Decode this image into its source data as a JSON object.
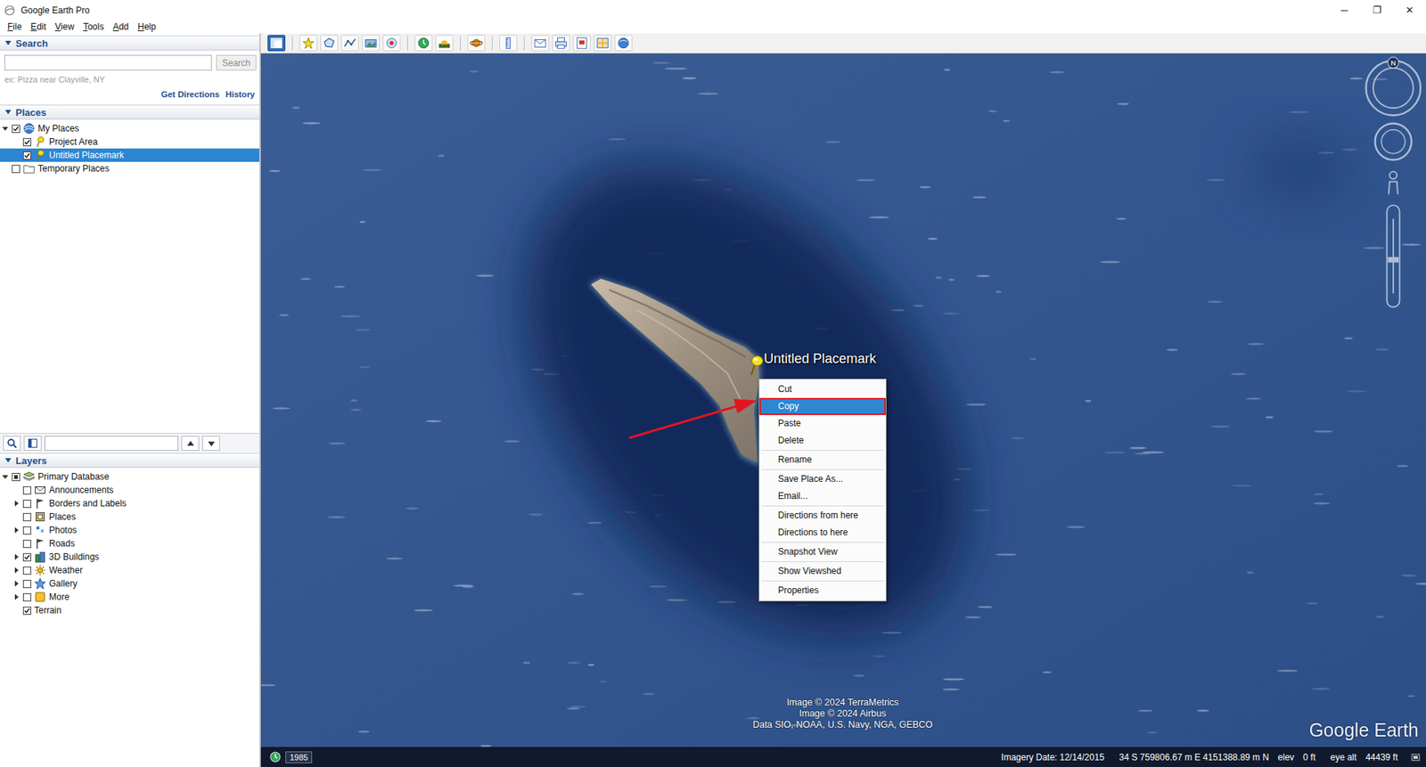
{
  "window": {
    "title": "Google Earth Pro",
    "controls": [
      "─",
      "❐",
      "✕"
    ]
  },
  "menu_bar": [
    "File",
    "Edit",
    "View",
    "Tools",
    "Add",
    "Help"
  ],
  "search_panel": {
    "title": "Search",
    "expanded": true,
    "query": "",
    "button": "Search",
    "button_disabled": true,
    "hint": "ex: Pizza near Clayville, NY",
    "links": [
      "Get Directions",
      "History"
    ]
  },
  "places_panel": {
    "title": "Places",
    "expanded": true,
    "items": [
      {
        "label": "My Places",
        "depth": 0,
        "expandable": true,
        "expanded": true,
        "checked": true,
        "partial": false,
        "selected": false
      },
      {
        "label": "Project Area",
        "depth": 1,
        "expandable": false,
        "expanded": false,
        "checked": true,
        "partial": false,
        "selected": false
      },
      {
        "label": "Untitled Placemark",
        "depth": 1,
        "expandable": false,
        "expanded": false,
        "checked": true,
        "partial": false,
        "selected": true
      },
      {
        "label": "Temporary Places",
        "depth": 0,
        "expandable": false,
        "expanded": false,
        "checked": false,
        "partial": false,
        "selected": false
      }
    ]
  },
  "places_toolbar": {
    "query": ""
  },
  "layers_panel": {
    "title": "Layers",
    "expanded": true,
    "items": [
      {
        "label": "Primary Database",
        "depth": 0,
        "expandable": true,
        "expanded": true,
        "checked": false,
        "partial": true,
        "selected": false
      },
      {
        "label": "Announcements",
        "depth": 1,
        "expandable": false,
        "expanded": false,
        "checked": false,
        "partial": false,
        "selected": false
      },
      {
        "label": "Borders and Labels",
        "depth": 1,
        "expandable": true,
        "expanded": false,
        "checked": false,
        "partial": false,
        "selected": false
      },
      {
        "label": "Places",
        "depth": 1,
        "expandable": false,
        "expanded": false,
        "checked": false,
        "partial": false,
        "selected": false
      },
      {
        "label": "Photos",
        "depth": 1,
        "expandable": true,
        "expanded": false,
        "checked": false,
        "partial": false,
        "selected": false
      },
      {
        "label": "Roads",
        "depth": 1,
        "expandable": false,
        "expanded": false,
        "checked": false,
        "partial": false,
        "selected": false
      },
      {
        "label": "3D Buildings",
        "depth": 1,
        "expandable": true,
        "expanded": false,
        "checked": true,
        "partial": false,
        "selected": false
      },
      {
        "label": "Weather",
        "depth": 1,
        "expandable": true,
        "expanded": false,
        "checked": false,
        "partial": false,
        "selected": false
      },
      {
        "label": "Gallery",
        "depth": 1,
        "expandable": true,
        "expanded": false,
        "checked": false,
        "partial": false,
        "selected": false
      },
      {
        "label": "More",
        "depth": 1,
        "expandable": true,
        "expanded": false,
        "checked": false,
        "partial": false,
        "selected": false
      },
      {
        "label": "Terrain",
        "depth": 1,
        "expandable": false,
        "expanded": false,
        "checked": true,
        "partial": false,
        "selected": false
      }
    ]
  },
  "map": {
    "placemark": {
      "label": "Untitled Placemark"
    },
    "compass_label": "N",
    "attribution": [
      "Image © 2024 TerraMetrics",
      "Image © 2024 Airbus",
      "Data SIO, NOAA, U.S. Navy, NGA, GEBCO"
    ],
    "logo": "Google Earth"
  },
  "context_menu": {
    "items": [
      {
        "label": "Cut",
        "selected": false,
        "group": 1
      },
      {
        "label": "Copy",
        "selected": true,
        "group": 1
      },
      {
        "label": "Paste",
        "selected": false,
        "group": 1
      },
      {
        "label": "Delete",
        "selected": false,
        "group": 1
      },
      {
        "label": "Rename",
        "selected": false,
        "group": 2
      },
      {
        "label": "Save Place As...",
        "selected": false,
        "group": 3
      },
      {
        "label": "Email...",
        "selected": false,
        "group": 3
      },
      {
        "label": "Directions from here",
        "selected": false,
        "group": 4
      },
      {
        "label": "Directions to here",
        "selected": false,
        "group": 4
      },
      {
        "label": "Snapshot View",
        "selected": false,
        "group": 5
      },
      {
        "label": "Show Viewshed",
        "selected": false,
        "group": 6
      },
      {
        "label": "Properties",
        "selected": false,
        "group": 7
      }
    ]
  },
  "status_bar": {
    "year": "1985",
    "imagery_date": "Imagery Date: 12/14/2015",
    "coordinates": "34 S 759806.67 m E 4151388.89 m N",
    "elev_label": "elev",
    "elev": "0 ft",
    "eye_alt_label": "eye alt",
    "eye_alt": "44439 ft"
  }
}
